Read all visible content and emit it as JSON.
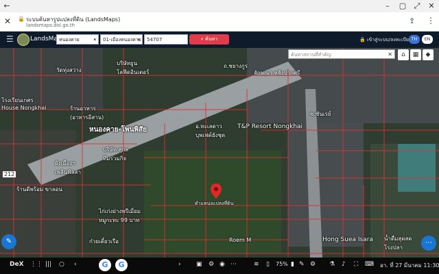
{
  "browser": {
    "tab_title": "ระบบค้นหารูปแปลงที่ดิน (LandsMaps)",
    "url": "landsmaps.dol.go.th"
  },
  "app": {
    "brand": "LandsMaps",
    "province": "หนองคาย",
    "district": "01-เมืองหนองคาย",
    "parcel_number": "54707",
    "search_label": "ค้นหา",
    "login_label": "เข้าสู่ระบบ/ลงทะเบียน",
    "lang_th": "TH",
    "lang_en": "EN"
  },
  "map": {
    "search_placeholder": "ค้นหาสถานที่สำคัญ",
    "labels": {
      "wat": "วัดทุ่งสว่าง",
      "chiang_yuen": "บริษัทยูน\nโลฟีดอินเตอร์",
      "road_chayaphruek": "ถ.ชยางกูร",
      "thumbs": "ลักษณา หลังปากศรี",
      "school": "โรงเรียนเกศร\nHouse Nongkhai",
      "restaurant": "ร้านอาหาร\n(อาหารอีสาน)",
      "main_road": "หนองคาย-โพนพิสัย",
      "bupphavet": "อ.ทะเลดาว\nบุพเฟต์ยังชุด",
      "tp_resort": "T&P Resort Nongkhai",
      "road_side": "ซ.ซันเรย์",
      "company_sukan": "บริษัท สุกล\nทีมร่วมกิจ",
      "nam_khong": "ผังเมืองฯ\nเพลินพิลสา",
      "route_212": "212",
      "grocery": "ร้านดีพร้อม ขาลอน",
      "parcel": "ตำแหน่งแปลงที่ดิน",
      "chicken": "ไก่เก่งย่างพรีเมี่ยม\nหมูกะทะ 99 บาท",
      "noodle": "ก๋วยเตี๋ยวเรือ",
      "road_roem": "Roem M",
      "hong_suea": "Hong Suea Isara",
      "nong_sa": "น้ำดื่มสุดสด\nโรงปลา"
    }
  },
  "taskbar": {
    "dex": "DeX",
    "battery": "75%",
    "datetime": "อา. ที่ 27 มีนาคม 11:30"
  }
}
